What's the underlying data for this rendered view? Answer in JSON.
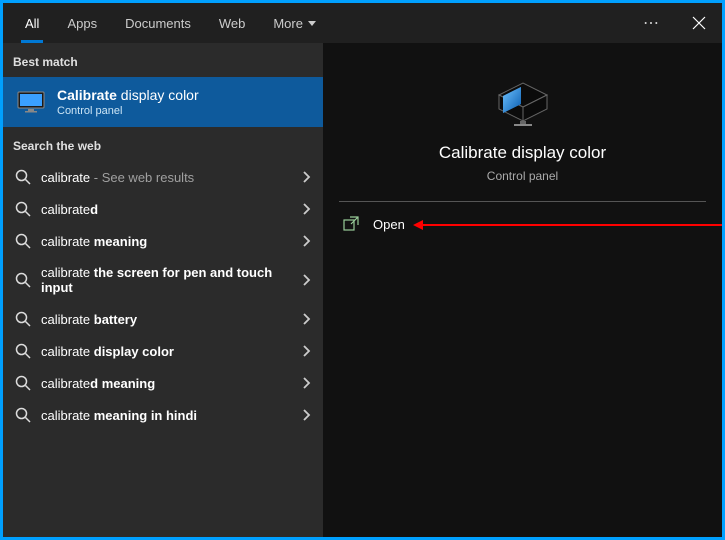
{
  "header": {
    "tabs": [
      "All",
      "Apps",
      "Documents",
      "Web",
      "More"
    ],
    "more_label": "⋯",
    "close_label": "✕"
  },
  "left": {
    "best_match_label": "Best match",
    "best_match": {
      "title_bold": "Calibrate",
      "title_rest": " display color",
      "subtitle": "Control panel"
    },
    "web_label": "Search the web",
    "results": [
      {
        "prefix": "calibrate",
        "dim": " - See web results",
        "bold": ""
      },
      {
        "prefix": "calibrate",
        "dim": "",
        "bold": "d"
      },
      {
        "prefix": "calibrate ",
        "dim": "",
        "bold": "meaning"
      },
      {
        "prefix": "calibrate ",
        "dim": "",
        "bold": "the screen for pen and touch input"
      },
      {
        "prefix": "calibrate ",
        "dim": "",
        "bold": "battery"
      },
      {
        "prefix": "calibrate ",
        "dim": "",
        "bold": "display color"
      },
      {
        "prefix": "calibrate",
        "dim": "",
        "bold": "d meaning"
      },
      {
        "prefix": "calibrate ",
        "dim": "",
        "bold": "meaning in hindi"
      }
    ]
  },
  "right": {
    "title": "Calibrate display color",
    "subtitle": "Control panel",
    "open_label": "Open"
  }
}
